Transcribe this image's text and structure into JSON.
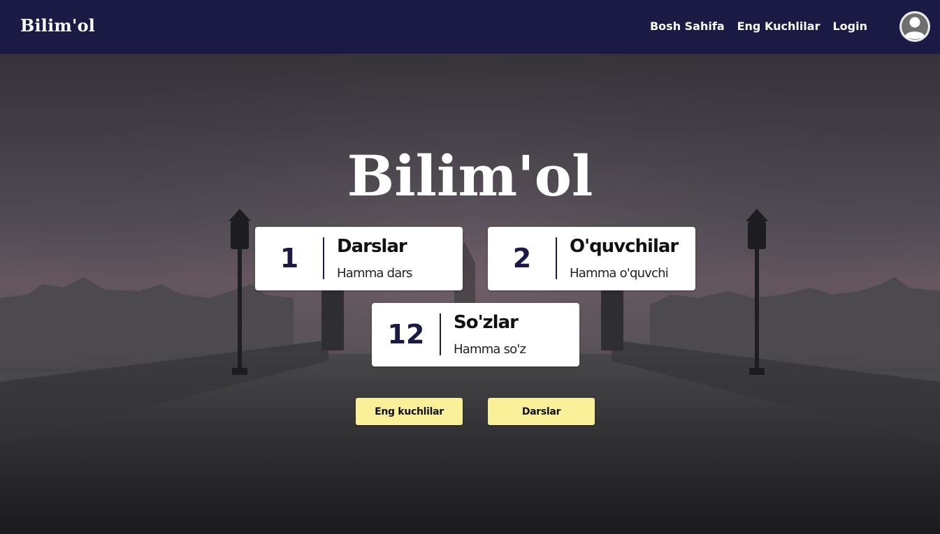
{
  "navbar": {
    "brand": "Bilim'ol",
    "links": {
      "home": "Bosh Sahifa",
      "top": "Eng Kuchlilar",
      "login": "Login"
    }
  },
  "hero": {
    "title": "Bilim'ol",
    "stats": {
      "lessons": {
        "value": "1",
        "label": "Darslar",
        "sub": "Hamma dars"
      },
      "students": {
        "value": "2",
        "label": "O'quvchilar",
        "sub": "Hamma o'quvchi"
      },
      "words": {
        "value": "12",
        "label": "So'zlar",
        "sub": "Hamma so'z"
      }
    },
    "buttons": {
      "top": "Eng kuchlilar",
      "lessons": "Darslar"
    }
  },
  "icons": {
    "avatar": "user-avatar-icon"
  },
  "colors": {
    "navbar_bg": "#1b1a45",
    "accent_button": "#fbf09a",
    "card_bg": "#ffffff",
    "number_color": "#1b1a45"
  }
}
